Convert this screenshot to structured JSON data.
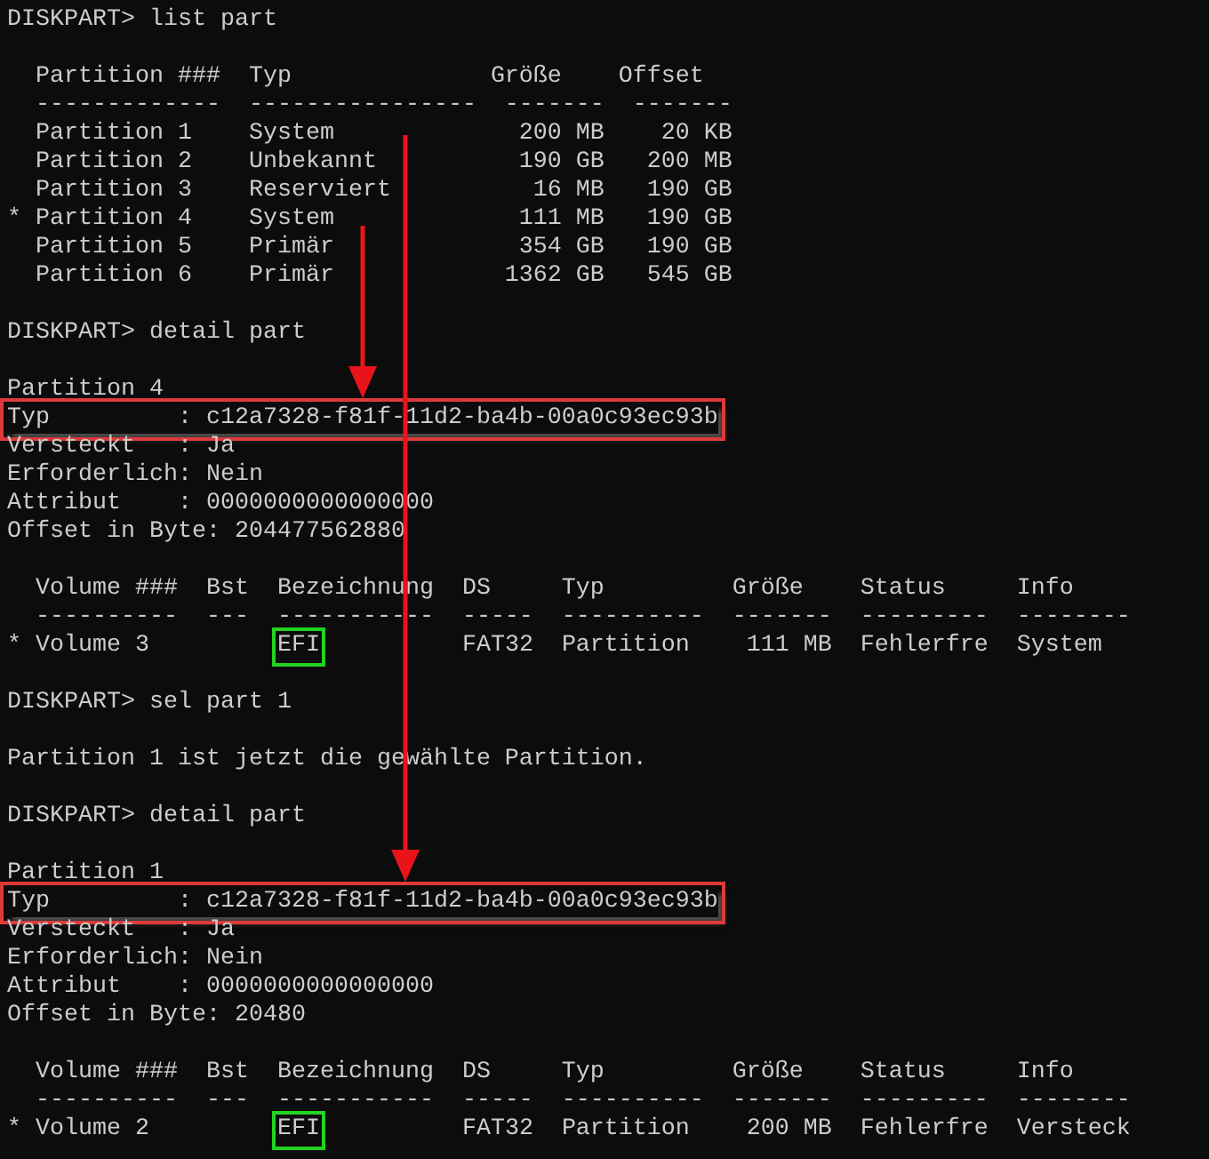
{
  "console": {
    "lines": [
      {
        "kind": "prompt",
        "text": "DISKPART> list part"
      },
      {
        "kind": "blank"
      },
      {
        "kind": "text",
        "text": "  Partition ###  Typ              Größe    Offset"
      },
      {
        "kind": "text",
        "text": "  -------------  ----------------  -------  -------"
      },
      {
        "kind": "text",
        "text": "  Partition 1    System             200 MB    20 KB"
      },
      {
        "kind": "text",
        "text": "  Partition 2    Unbekannt          190 GB   200 MB"
      },
      {
        "kind": "text",
        "text": "  Partition 3    Reserviert          16 MB   190 GB"
      },
      {
        "kind": "text",
        "text": "* Partition 4    System             111 MB   190 GB"
      },
      {
        "kind": "text",
        "text": "  Partition 5    Primär             354 GB   190 GB"
      },
      {
        "kind": "text",
        "text": "  Partition 6    Primär            1362 GB   545 GB"
      },
      {
        "kind": "blank"
      },
      {
        "kind": "prompt",
        "text": "DISKPART> detail part"
      },
      {
        "kind": "blank"
      },
      {
        "kind": "text",
        "text": "Partition 4"
      },
      {
        "kind": "boxed",
        "text": "Typ         : c12a7328-f81f-11d2-ba4b-00a0c93ec93b"
      },
      {
        "kind": "text",
        "text": "Versteckt   : Ja"
      },
      {
        "kind": "text",
        "text": "Erforderlich: Nein"
      },
      {
        "kind": "text",
        "text": "Attribut    : 0000000000000000"
      },
      {
        "kind": "text",
        "text": "Offset in Byte: 204477562880"
      },
      {
        "kind": "blank"
      },
      {
        "kind": "text",
        "text": "  Volume ###  Bst  Bezeichnung  DS     Typ         Größe    Status     Info"
      },
      {
        "kind": "text",
        "text": "  ----------  ---  -----------  -----  ----------  -------  ---------  --------"
      },
      {
        "kind": "marked",
        "before": "* Volume 3         ",
        "mark": "EFI",
        "after": "          FAT32  Partition    111 MB  Fehlerfre  System"
      },
      {
        "kind": "blank"
      },
      {
        "kind": "prompt",
        "text": "DISKPART> sel part 1"
      },
      {
        "kind": "blank"
      },
      {
        "kind": "text",
        "text": "Partition 1 ist jetzt die gewählte Partition."
      },
      {
        "kind": "blank"
      },
      {
        "kind": "prompt",
        "text": "DISKPART> detail part"
      },
      {
        "kind": "blank"
      },
      {
        "kind": "text",
        "text": "Partition 1"
      },
      {
        "kind": "boxed",
        "text": "Typ         : c12a7328-f81f-11d2-ba4b-00a0c93ec93b"
      },
      {
        "kind": "text",
        "text": "Versteckt   : Ja"
      },
      {
        "kind": "text",
        "text": "Erforderlich: Nein"
      },
      {
        "kind": "text",
        "text": "Attribut    : 0000000000000000"
      },
      {
        "kind": "text",
        "text": "Offset in Byte: 20480"
      },
      {
        "kind": "blank"
      },
      {
        "kind": "text",
        "text": "  Volume ###  Bst  Bezeichnung  DS     Typ         Größe    Status     Info"
      },
      {
        "kind": "text",
        "text": "  ----------  ---  -----------  -----  ----------  -------  ---------  --------"
      },
      {
        "kind": "marked",
        "before": "* Volume 2         ",
        "mark": "EFI",
        "after": "          FAT32  Partition    200 MB  Fehlerfre  Versteck"
      }
    ]
  }
}
